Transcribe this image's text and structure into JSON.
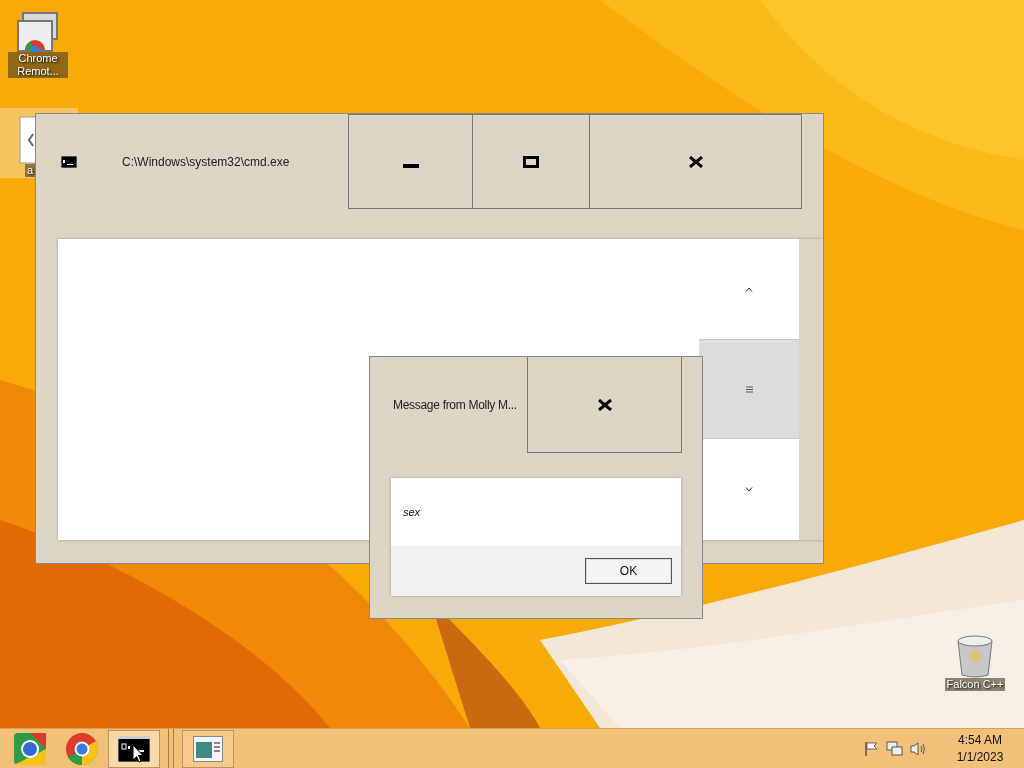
{
  "desktop_icons": [
    {
      "kind": "remote",
      "label": "Chrome Remot..."
    },
    {
      "kind": "document",
      "label": "a"
    },
    {
      "kind": "bin",
      "label": "Falcon C++"
    }
  ],
  "console_window": {
    "title": "C:\\Windows\\system32\\cmd.exe"
  },
  "dialog": {
    "title": "Message from Molly M...",
    "message": "sex",
    "ok_button": "OK"
  },
  "taskbar": {
    "apps": [
      {
        "kind": "remote",
        "selected": false,
        "running": false
      },
      {
        "kind": "browser",
        "selected": false,
        "running": false
      },
      {
        "kind": "console",
        "selected": true,
        "running": true
      },
      {
        "kind": "window",
        "selected": false,
        "running": true
      }
    ]
  },
  "clock": {
    "time": "4:54 AM",
    "date": "1/1/2023"
  }
}
